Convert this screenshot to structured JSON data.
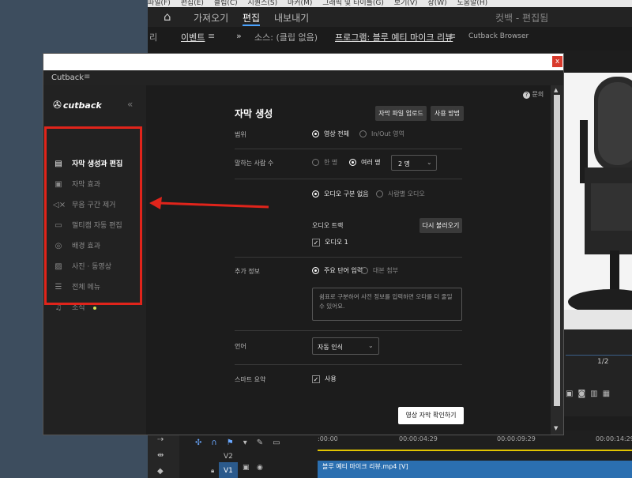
{
  "premiere": {
    "menubar": [
      "파일(F)",
      "편집(E)",
      "클립(C)",
      "시퀀스(S)",
      "마커(M)",
      "그래픽 및 타이틀(G)",
      "보기(V)",
      "창(W)",
      "도움말(H)"
    ],
    "workspace_tabs": [
      "가져오기",
      "편집",
      "내보내기"
    ],
    "workspace_title": "컷백 - 편집됨",
    "panel_tabs": {
      "left_partial": "리",
      "events": "이벤트",
      "source": "소스: (클립 없음)",
      "program": "프로그램: 블루 예티 마이크 리뷰",
      "cutback_browser": "Cutback Browser"
    },
    "timecode": "1/2",
    "timeline": {
      "times": [
        ":00:00",
        "00:00:04:29",
        "00:00:09:29",
        "00:00:14:29"
      ],
      "tracks": [
        "V2",
        "V1"
      ],
      "clip_name": "블루 예티 마이크 리뷰.mp4 [V]"
    }
  },
  "window": {
    "title": "Cutback",
    "close_glyph": "x",
    "menu_glyph": "≡"
  },
  "sidebar": {
    "logo": "cutback",
    "collapse_glyph": "«",
    "items": [
      {
        "icon": "subtitle-edit-icon",
        "glyph": "▤",
        "label": "자막 생성과 편집",
        "active": true
      },
      {
        "icon": "subtitle-effect-icon",
        "glyph": "▣",
        "label": "자막 효과",
        "active": false
      },
      {
        "icon": "mute-icon",
        "glyph": "◁×",
        "label": "무음 구간 제거",
        "active": false
      },
      {
        "icon": "multicam-icon",
        "glyph": "▭",
        "label": "멀티캠 자동 편집",
        "active": false
      },
      {
        "icon": "background-effect-icon",
        "glyph": "◎",
        "label": "배경 효과",
        "active": false
      },
      {
        "icon": "image-icon",
        "glyph": "▨",
        "label": "사진 · 동영상",
        "active": false
      },
      {
        "icon": "menu-icon",
        "glyph": "☰",
        "label": "전체 메뉴",
        "active": false
      },
      {
        "icon": "bell-icon",
        "glyph": "♫",
        "label": "소식",
        "active": false
      }
    ],
    "news_dot_color": "#d4e157"
  },
  "main": {
    "help_label": "문의",
    "title": "자막 생성",
    "upload_button": "자막 파일 업로드",
    "howto_button": "사용 방법",
    "range": {
      "label": "범위",
      "options": [
        "영상 전체",
        "In/Out 영역"
      ],
      "selected": 0
    },
    "speakers": {
      "label": "말하는 사람 수",
      "options": [
        "한 명",
        "여러 명"
      ],
      "selected": 1,
      "count": "2 명"
    },
    "audio_split": {
      "options": [
        "오디오 구분 없음",
        "사람별 오디오"
      ],
      "selected": 0
    },
    "audio_track": {
      "label": "오디오 트랙",
      "reload_button": "다시 불러오기",
      "track": "오디오 1",
      "checked": true
    },
    "extra_info": {
      "label": "추가 정보",
      "options": [
        "주요 단어 입력",
        "대본 첨부"
      ],
      "selected": 0,
      "placeholder": "쉼표로 구분하여 사전 정보를 입력하면 오타를 더 줄일 수 있어요."
    },
    "language": {
      "label": "언어",
      "value": "자동 인식"
    },
    "smart_summary": {
      "label": "스마트 요약",
      "checkbox_label": "사용",
      "checked": true
    },
    "confirm_button": "영상 자막 확인하기"
  },
  "annotation": {
    "color": "#e0241b"
  }
}
